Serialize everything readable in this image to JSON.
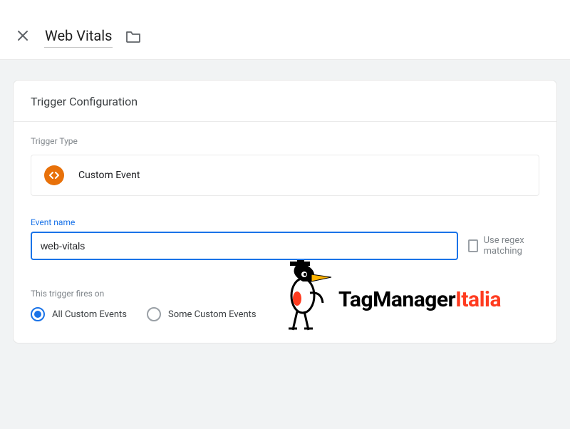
{
  "header": {
    "title": "Web Vitals"
  },
  "card": {
    "title": "Trigger Configuration",
    "trigger_type_label": "Trigger Type",
    "trigger_type_value": "Custom Event",
    "event_name_label": "Event name",
    "event_name_value": "web-vitals",
    "use_regex_label": "Use regex matching",
    "use_regex_checked": false,
    "fires_label": "This trigger fires on",
    "radios": {
      "all": {
        "label": "All Custom Events",
        "checked": true
      },
      "some": {
        "label": "Some Custom Events",
        "checked": false
      }
    }
  },
  "watermark": {
    "part1": "TagManager",
    "part2": "Italia"
  }
}
